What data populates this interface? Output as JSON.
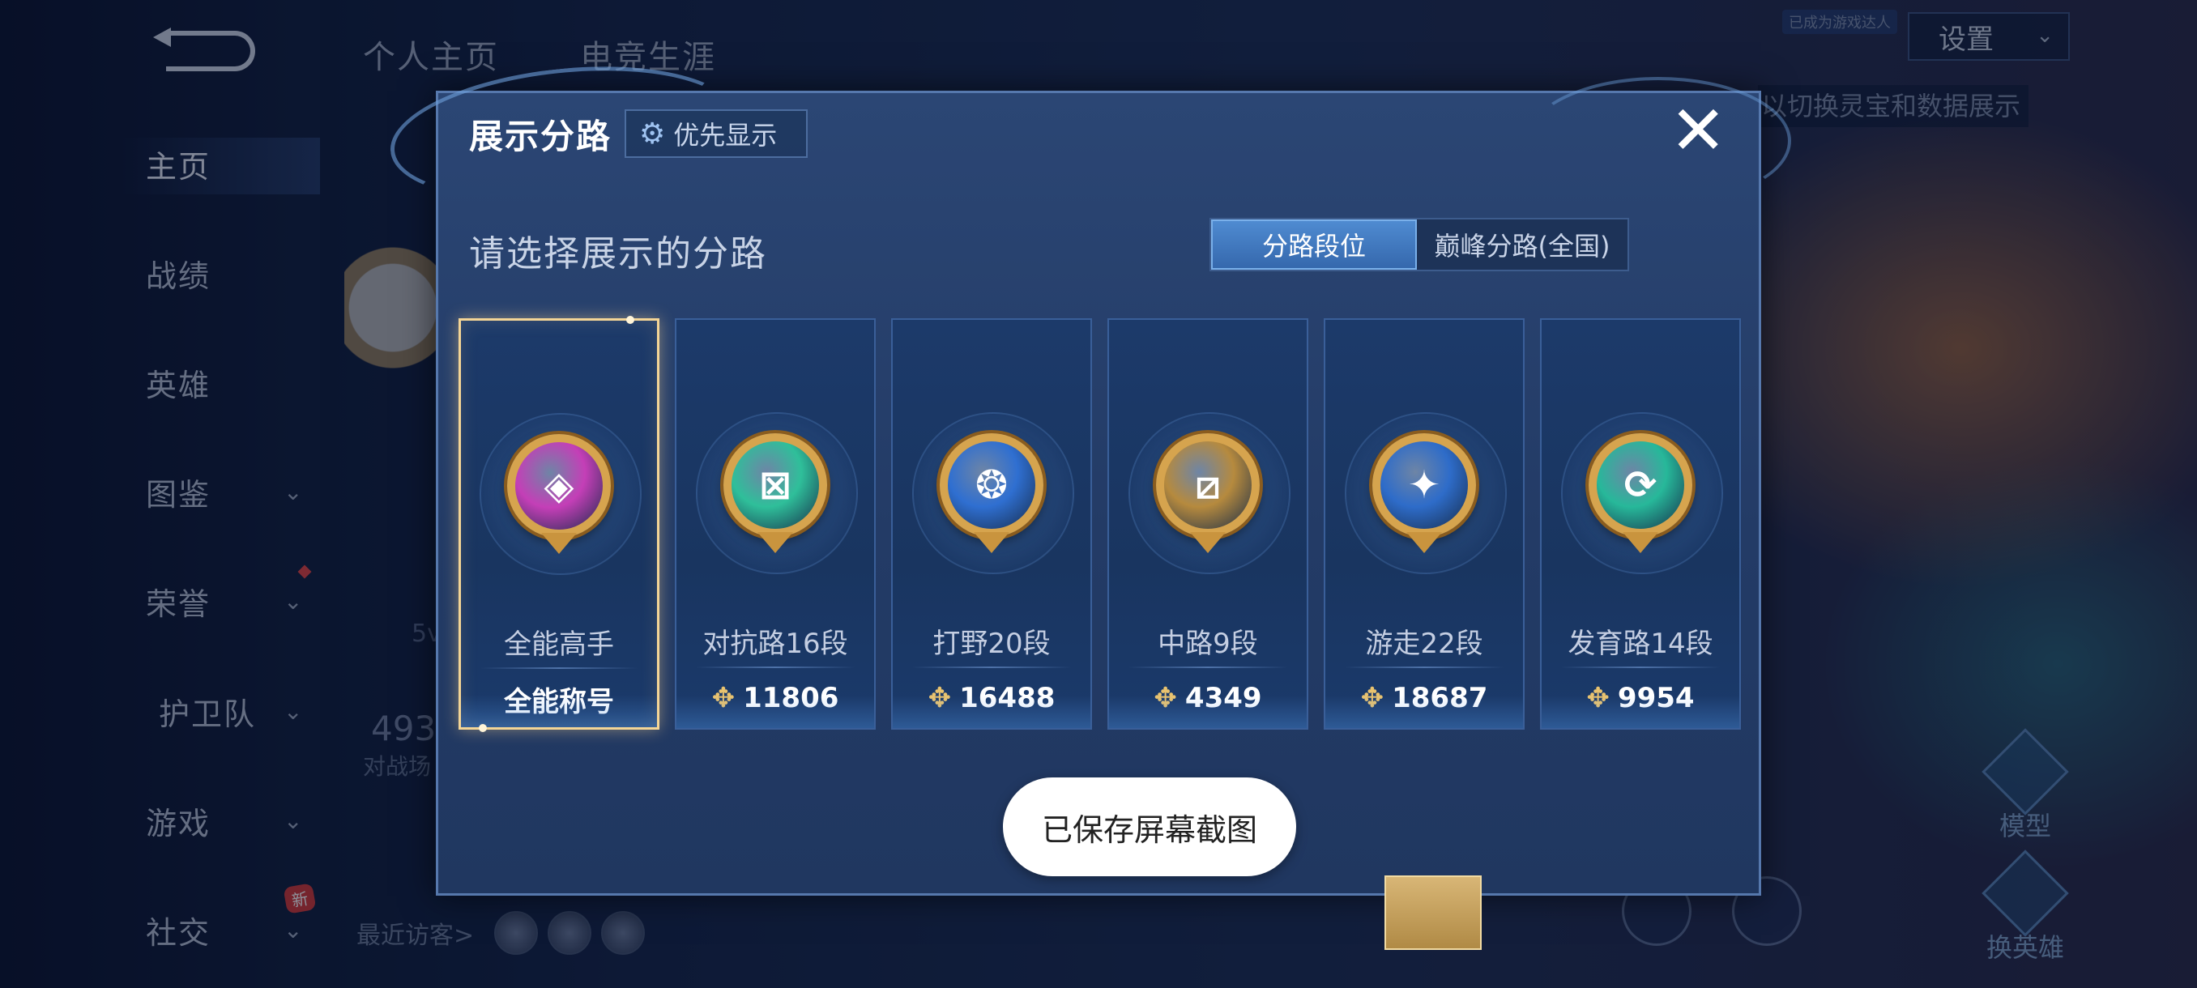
{
  "background": {
    "nav": {
      "items": [
        {
          "label": "主页",
          "has_dropdown": false,
          "active": true
        },
        {
          "label": "战绩",
          "has_dropdown": false
        },
        {
          "label": "英雄",
          "has_dropdown": false
        },
        {
          "label": "图鉴",
          "has_dropdown": true
        },
        {
          "label": "荣誉",
          "has_dropdown": true
        },
        {
          "label": "护卫队",
          "has_dropdown": true
        },
        {
          "label": "游戏",
          "has_dropdown": true
        },
        {
          "label": "社交",
          "has_dropdown": true
        }
      ],
      "new_badge": "新"
    },
    "top_tabs": [
      "个人主页",
      "电竞生涯"
    ],
    "settings_label": "设置",
    "top_note": "已成为游戏达人",
    "right_hint": "以切换灵宝和数据展示",
    "right_buttons": [
      "模型",
      "换英雄"
    ],
    "partial_values": {
      "count": "493",
      "label": "对战场",
      "mode": "5v"
    },
    "recent_visitors_label": "最近访客>"
  },
  "dialog": {
    "title": "展示分路",
    "priority_button": "优先显示",
    "subtitle": "请选择展示的分路",
    "segments": [
      {
        "label": "分路段位",
        "selected": true
      },
      {
        "label": "巅峰分路(全国)",
        "selected": false
      }
    ],
    "cards": [
      {
        "lane": "全能高手",
        "value": "全能称号",
        "show_points_icon": false,
        "selected": true,
        "badge_color": "#c43fb7",
        "icon": "all-round-icon"
      },
      {
        "lane": "对抗路16段",
        "value": "11806",
        "show_points_icon": true,
        "selected": false,
        "badge_color": "#2fbf9a",
        "icon": "clash-lane-icon"
      },
      {
        "lane": "打野20段",
        "value": "16488",
        "show_points_icon": true,
        "selected": false,
        "badge_color": "#2f6fd1",
        "icon": "jungle-icon"
      },
      {
        "lane": "中路9段",
        "value": "4349",
        "show_points_icon": true,
        "selected": false,
        "badge_color": "#b68a3e",
        "icon": "mid-lane-icon"
      },
      {
        "lane": "游走22段",
        "value": "18687",
        "show_points_icon": true,
        "selected": false,
        "badge_color": "#2e6cc9",
        "icon": "roam-icon"
      },
      {
        "lane": "发育路14段",
        "value": "9954",
        "show_points_icon": true,
        "selected": false,
        "badge_color": "#27b89a",
        "icon": "farm-lane-icon"
      }
    ]
  },
  "toast": {
    "message": "已保存屏幕截图"
  },
  "colors": {
    "dialog_bg": "#2b4674",
    "selected_border": "#f4d596",
    "segment_active": "#4f8bd1",
    "points_icon": "#e9c36f"
  }
}
